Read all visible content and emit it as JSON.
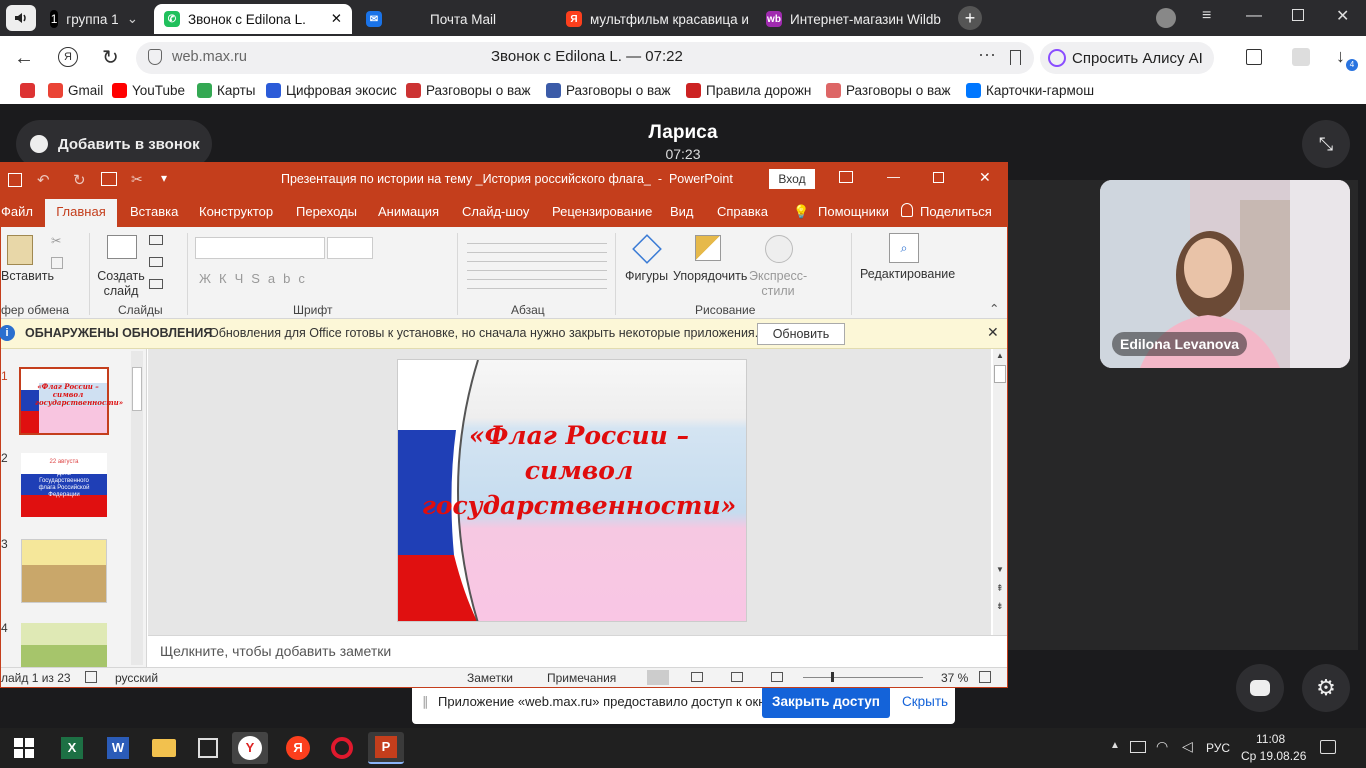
{
  "browser": {
    "tabs": [
      {
        "label": "группа 1",
        "count": "1",
        "icon": "people-icon"
      },
      {
        "label": "Звонок с Edilona L.",
        "icon": "phone-icon",
        "active": true
      },
      {
        "label": "Почта Mail",
        "icon": "mail-icon"
      },
      {
        "label": "мультфильм красавица и",
        "icon": "yandex-icon"
      },
      {
        "label": "Интернет-магазин Wildb",
        "icon": "wb-icon"
      }
    ],
    "address": "web.max.ru",
    "page_title": "Звонок с Edilona L. — 07:22",
    "alice_label": "Спросить Алису AI",
    "downloads_badge": "4",
    "bookmarks": [
      "Gmail",
      "YouTube",
      "Карты",
      "Цифровая экосис",
      "Разговоры о важ",
      "Разговоры о важ",
      "Правила дорожн",
      "Разговоры о важ",
      "Карточки-гармош"
    ]
  },
  "call": {
    "add_label": "Добавить в звонок",
    "caller_name": "Лариса",
    "timer": "07:23",
    "participant_name": "Edilona Levanova",
    "share_notice": "Приложение «web.max.ru» предоставило доступ к окну.",
    "close_access_label": "Закрыть доступ",
    "hide_label": "Скрыть"
  },
  "ppt": {
    "title": "Презентация по истории на тему _История российского флага_  -  PowerPoint",
    "login_label": "Вход",
    "tabs": [
      "Файл",
      "Главная",
      "Вставка",
      "Конструктор",
      "Переходы",
      "Анимация",
      "Слайд-шоу",
      "Рецензирование",
      "Вид",
      "Справка",
      "Помощники",
      "Поделиться"
    ],
    "ribbon": {
      "paste": "Вставить",
      "clipboard": "фер обмена",
      "new_slide": "Создать слайд",
      "slides": "Слайды",
      "font": "Шрифт",
      "paragraph": "Абзац",
      "shapes": "Фигуры",
      "arrange": "Упорядочить",
      "styles": "Экспресс-стили",
      "drawing": "Рисование",
      "editing": "Редактирование"
    },
    "update_bar": {
      "title": "ОБНАРУЖЕНЫ ОБНОВЛЕНИЯ",
      "text": "Обновления для Office готовы к установке, но сначала нужно закрыть некоторые приложения.",
      "button": "Обновить"
    },
    "thumb_numbers": [
      "1",
      "2",
      "3",
      "4"
    ],
    "thumb2_text": [
      "22 августа",
      "День Государственного флага Российской Федерации"
    ],
    "slide_title": "«Флаг России – символ государственности»",
    "notes_placeholder": "Щелкните, чтобы добавить заметки",
    "status": {
      "slide_of": "лайд 1 из 23",
      "language": "русский",
      "notes": "Заметки",
      "comments": "Примечания",
      "zoom": "37 %"
    }
  },
  "taskbar": {
    "time": "11:08",
    "date": "Ср 19.08.26",
    "lang": "РУС"
  },
  "colors": {
    "ppt_accent": "#c43e1c",
    "call_bg": "#1b1b1d",
    "primary_button": "#1463d9"
  }
}
